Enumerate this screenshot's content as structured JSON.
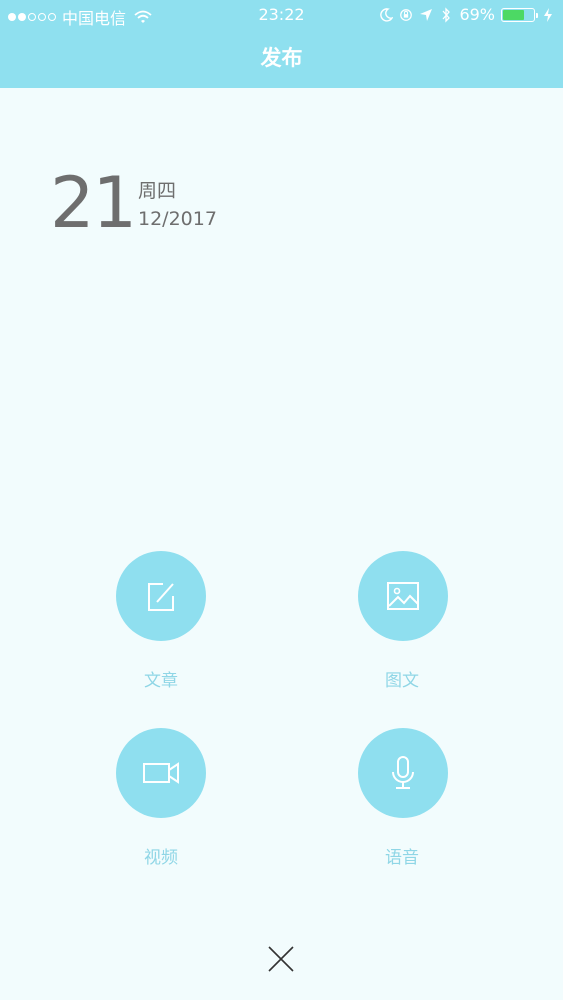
{
  "status_bar": {
    "carrier": "中国电信",
    "time": "23:22",
    "battery_percent": "69%",
    "battery_level": 0.69,
    "icons": [
      "signal-dots",
      "wifi-icon",
      "moon-icon",
      "rotation-lock-icon",
      "location-icon",
      "bluetooth-icon",
      "battery-icon",
      "charging-icon"
    ]
  },
  "nav": {
    "title": "发布"
  },
  "date": {
    "day": "21",
    "weekday": "周四",
    "month_year": "12/2017"
  },
  "actions": [
    {
      "label": "文章",
      "icon": "edit-icon"
    },
    {
      "label": "图文",
      "icon": "image-icon"
    },
    {
      "label": "视频",
      "icon": "video-icon"
    },
    {
      "label": "语音",
      "icon": "microphone-icon"
    }
  ],
  "close": {
    "icon": "close-icon"
  },
  "colors": {
    "header": "#8fe0ef",
    "background": "#f2fcfd",
    "action_circle": "#8fdfef",
    "label": "#8fd6e6",
    "date_text": "#6e6e6e",
    "battery": "#4cd964"
  }
}
